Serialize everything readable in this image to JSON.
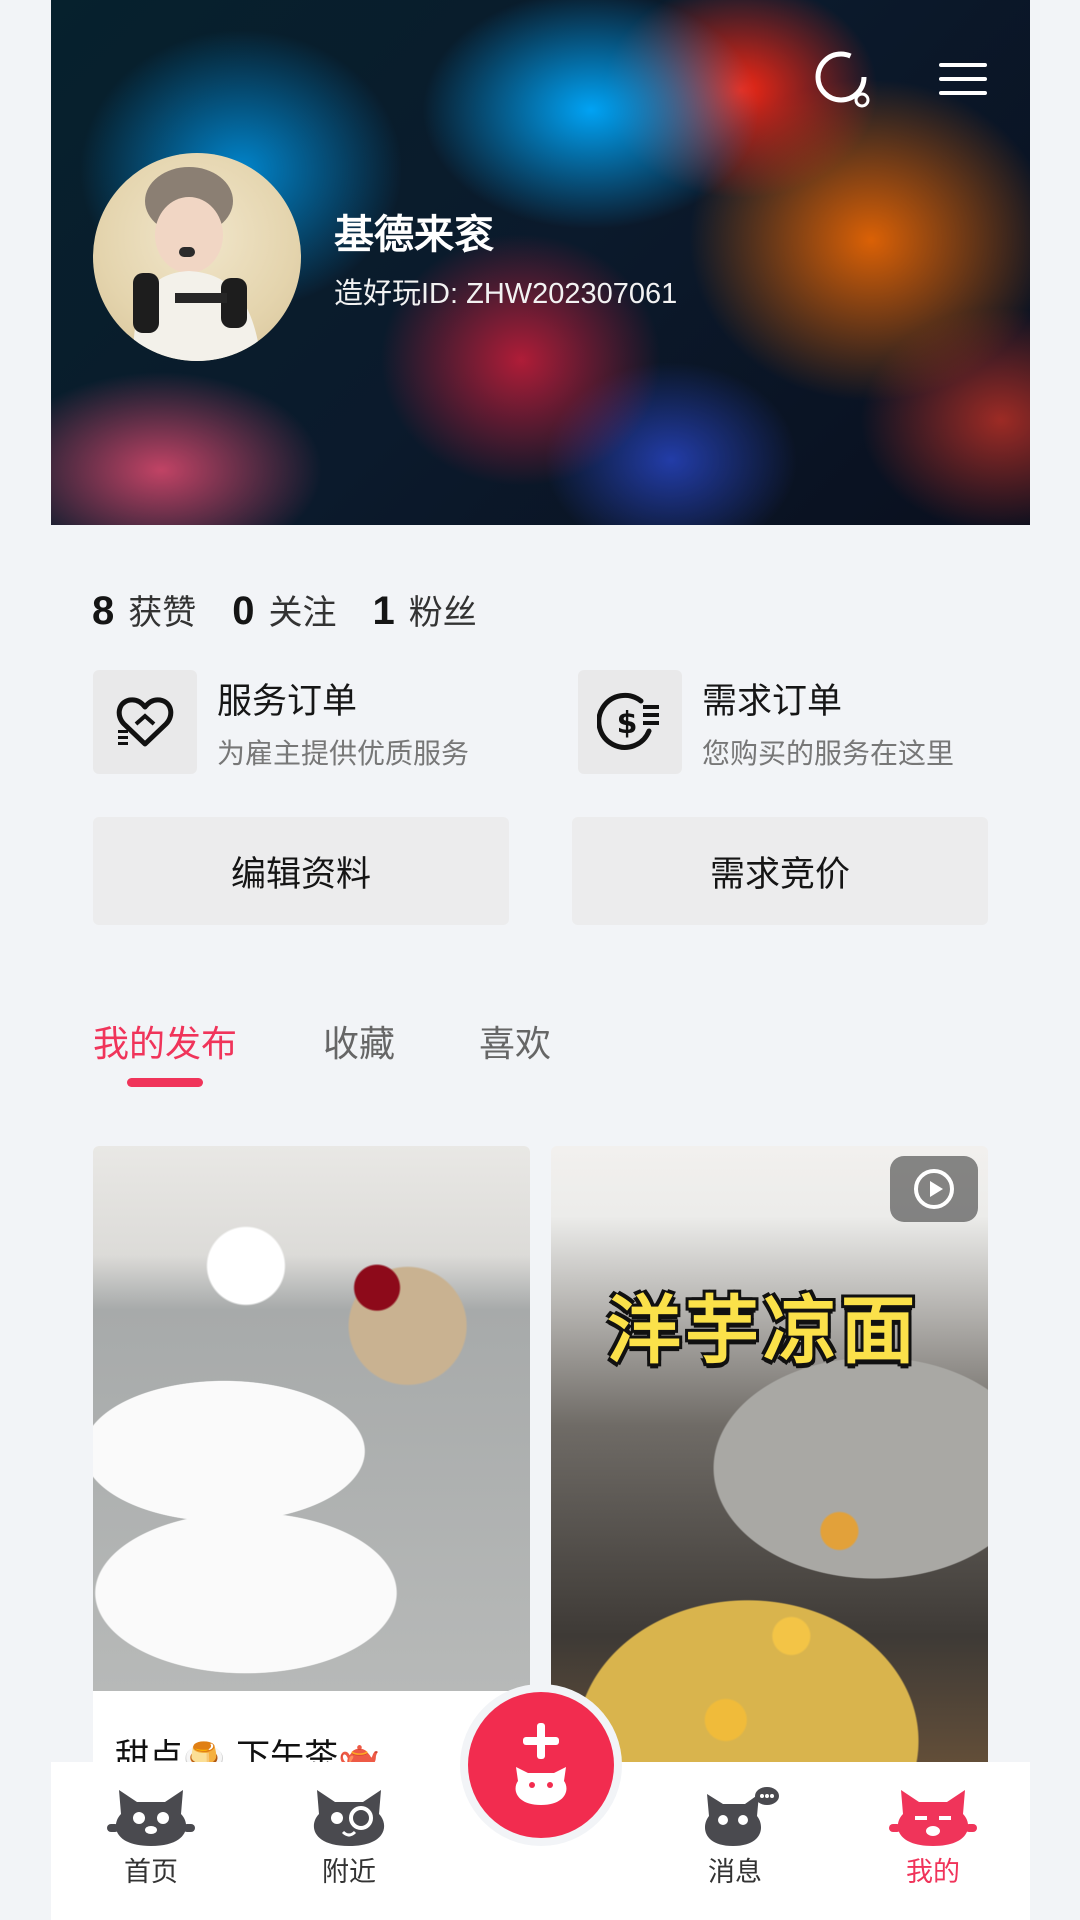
{
  "profile": {
    "name": "基德来衮",
    "id_line": "造好玩ID: ZHW202307061"
  },
  "stats": [
    {
      "value": "8",
      "label": "获赞"
    },
    {
      "value": "0",
      "label": "关注"
    },
    {
      "value": "1",
      "label": "粉丝"
    }
  ],
  "orders": {
    "service": {
      "title": "服务订单",
      "subtitle": "为雇主提供优质服务",
      "icon": "heart-service-icon"
    },
    "demand": {
      "title": "需求订单",
      "subtitle": "您购买的服务在这里",
      "icon": "dollar-coin-icon"
    }
  },
  "actions": {
    "edit_profile": "编辑资料",
    "demand_bidding": "需求竞价"
  },
  "tabs": [
    {
      "label": "我的发布",
      "active": true
    },
    {
      "label": "收藏",
      "active": false
    },
    {
      "label": "喜欢",
      "active": false
    }
  ],
  "posts": [
    {
      "caption": "甜点🍮 下午茶🫖",
      "image": "dessert-photo"
    },
    {
      "banner": "洋芋凉面",
      "image": "cooking-potatoes-photo",
      "is_video": true
    }
  ],
  "nav": {
    "items": [
      {
        "label": "首页",
        "icon": "cat-home-icon"
      },
      {
        "label": "附近",
        "icon": "cat-nearby-icon"
      },
      {
        "label": "消息",
        "icon": "cat-message-icon"
      },
      {
        "label": "我的",
        "icon": "cat-me-icon",
        "active": true
      }
    ],
    "fab_icon": "plus-cat-icon"
  },
  "colors": {
    "accent": "#f0345a",
    "fab": "#f22c4f",
    "page_bg": "#f2f4f7",
    "card_bg": "#ececed"
  }
}
